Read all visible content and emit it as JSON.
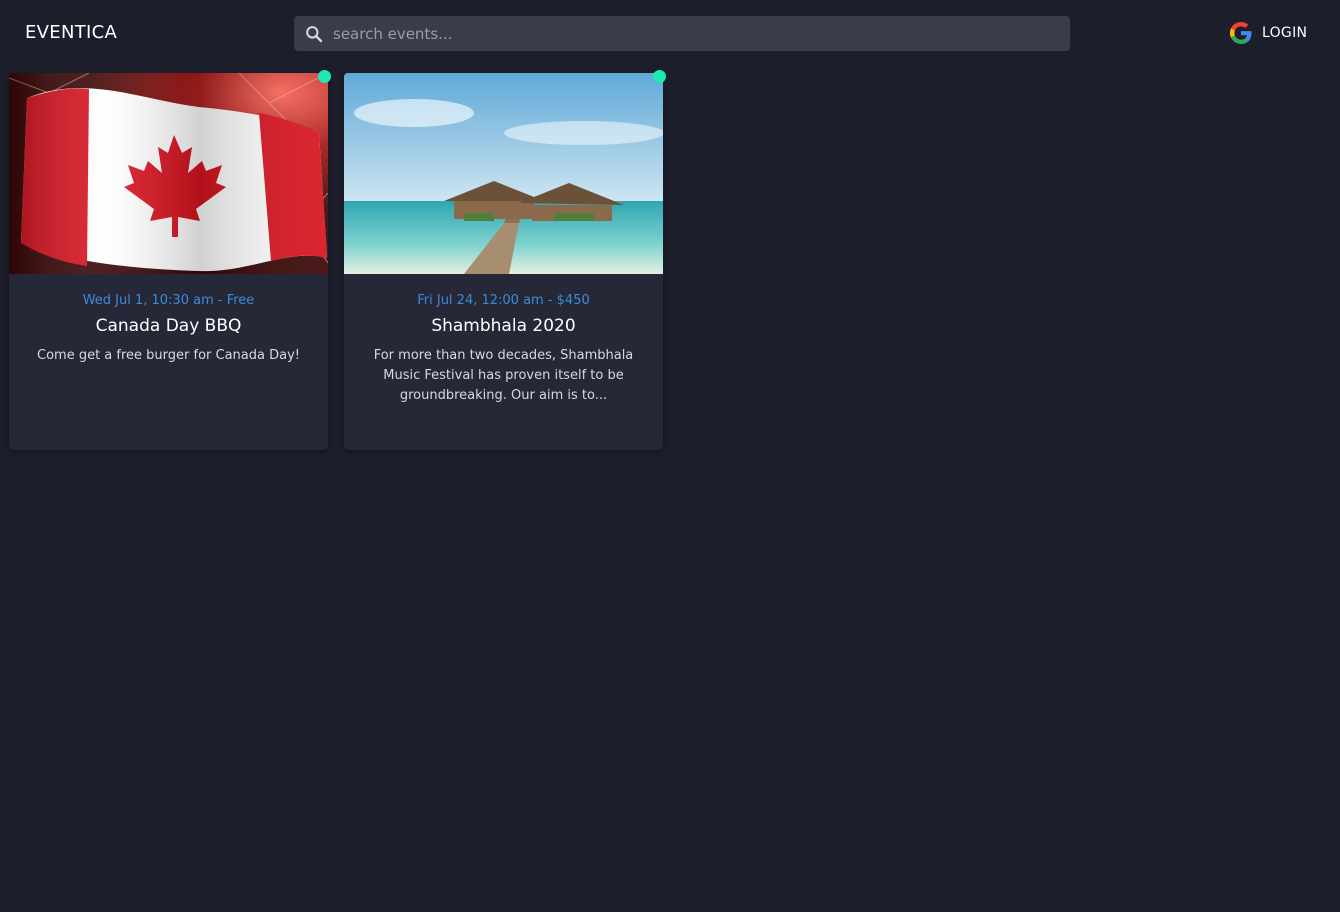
{
  "header": {
    "brand": "EVENTICA",
    "search_placeholder": "search events...",
    "login_label": "LOGIN"
  },
  "events": [
    {
      "meta": "Wed Jul 1, 10:30 am - Free",
      "title": "Canada Day BBQ",
      "description": "Come get a free burger for Canada Day!",
      "image": "canada-flag-fireworks",
      "status_color": "#1de9b6"
    },
    {
      "meta": "Fri Jul 24, 12:00 am - $450",
      "title": "Shambhala 2020",
      "description": "For more than two decades, Shambhala Music Festival has proven itself to be groundbreaking. Our aim is to...",
      "image": "tropical-beach-bungalow",
      "status_color": "#1de9b6"
    }
  ],
  "colors": {
    "background": "#1d1e2b",
    "card": "#272837",
    "accent": "#3b8bd6",
    "search": "#3a3b4b",
    "status": "#1de9b6"
  }
}
